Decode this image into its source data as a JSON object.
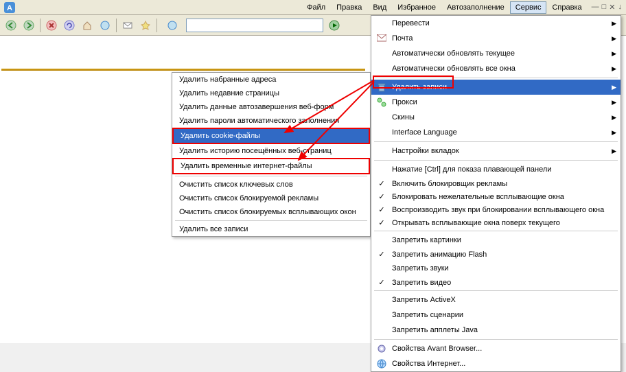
{
  "menubar": {
    "items": [
      "Файл",
      "Правка",
      "Вид",
      "Избранное",
      "Автозаполнение",
      "Сервис",
      "Справка"
    ],
    "active": "Сервис"
  },
  "dropdown": {
    "rows": [
      {
        "type": "item",
        "label": "Перевести",
        "arrow": true
      },
      {
        "type": "item",
        "label": "Почта",
        "icon": "mail",
        "arrow": true
      },
      {
        "type": "item",
        "label": "Автоматически обновлять текущее",
        "arrow": true
      },
      {
        "type": "item",
        "label": "Автоматически обновлять все окна",
        "arrow": true
      },
      {
        "type": "sep"
      },
      {
        "type": "item",
        "label": "Удалить записи",
        "icon": "trash",
        "arrow": true,
        "sel": true
      },
      {
        "type": "item",
        "label": "Прокси",
        "icon": "proxy",
        "arrow": true
      },
      {
        "type": "item",
        "label": "Скины",
        "arrow": true
      },
      {
        "type": "item",
        "label": "Interface Language",
        "arrow": true
      },
      {
        "type": "sep"
      },
      {
        "type": "item",
        "label": "Настройки вкладок",
        "arrow": true
      },
      {
        "type": "sep"
      },
      {
        "type": "item",
        "label": "Нажатие [Ctrl] для показа плавающей панели"
      },
      {
        "type": "item",
        "label": "Включить блокировщик рекламы",
        "check": true
      },
      {
        "type": "item",
        "label": "Блокировать нежелательные всплывающие окна",
        "check": true
      },
      {
        "type": "item",
        "label": "Воспроизводить звук при блокировании всплывающего окна",
        "check": true
      },
      {
        "type": "item",
        "label": "Открывать всплывающие окна поверх текущего",
        "check": true
      },
      {
        "type": "sep"
      },
      {
        "type": "item",
        "label": "Запретить картинки"
      },
      {
        "type": "item",
        "label": "Запретить анимацию Flash",
        "check": true
      },
      {
        "type": "item",
        "label": "Запретить звуки"
      },
      {
        "type": "item",
        "label": "Запретить видео",
        "check": true
      },
      {
        "type": "sep"
      },
      {
        "type": "item",
        "label": "Запретить ActiveX"
      },
      {
        "type": "item",
        "label": "Запретить сценарии"
      },
      {
        "type": "item",
        "label": "Запретить апплеты Java"
      },
      {
        "type": "sep"
      },
      {
        "type": "item",
        "label": "Свойства Avant Browser...",
        "icon": "gear"
      },
      {
        "type": "item",
        "label": "Свойства Интернет...",
        "icon": "globe"
      }
    ]
  },
  "submenu": {
    "rows": [
      {
        "label": "Удалить набранные адреса"
      },
      {
        "label": "Удалить недавние страницы"
      },
      {
        "label": "Удалить данные автозавершения веб-форм"
      },
      {
        "label": "Удалить пароли автоматического заполнения"
      },
      {
        "label": "Удалить cookie-файлы",
        "sel": true,
        "hl": true
      },
      {
        "label": "Удалить историю посещённых веб-страниц"
      },
      {
        "label": "Удалить временные интернет-файлы",
        "hl": true
      },
      {
        "type": "sep"
      },
      {
        "label": "Очистить список ключевых слов"
      },
      {
        "label": "Очистить список блокируемой рекламы"
      },
      {
        "label": "Очистить список блокируемых всплывающих окон"
      },
      {
        "type": "sep"
      },
      {
        "label": "Удалить все записи"
      }
    ]
  }
}
